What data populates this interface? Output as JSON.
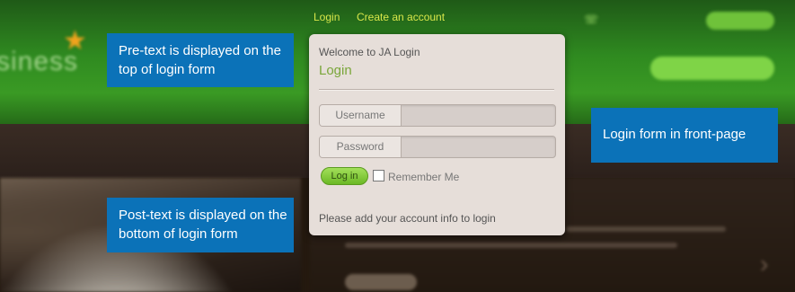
{
  "top_links": {
    "login": "Login",
    "create_account": "Create an account"
  },
  "login_box": {
    "pretext": "Welcome to JA Login",
    "title": "Login",
    "username_label": "Username",
    "password_label": "Password",
    "login_button": "Log in",
    "remember_me": "Remember Me",
    "posttext": "Please add your account info to login"
  },
  "callouts": {
    "pretext": "Pre-text is displayed on the top of login form",
    "posttext": "Post-text is displayed on the bottom of login form",
    "frontpage": "Login form in front-page"
  },
  "colors": {
    "callout": "#0b72b8",
    "link": "#d8e64a",
    "login_title": "#7aa63a",
    "login_button": "#7fc63a"
  }
}
